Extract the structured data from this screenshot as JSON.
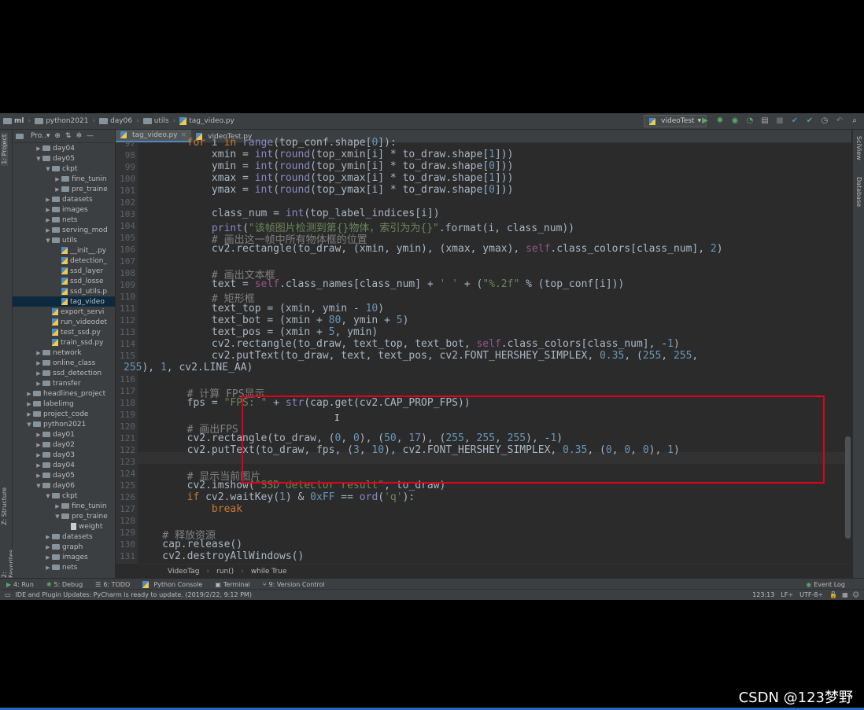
{
  "nav": {
    "crumbs": [
      "ml",
      "python2021",
      "day06",
      "utils",
      "tag_video.py"
    ],
    "run_config": "videoTest"
  },
  "left_stripe": {
    "project": "1: Project",
    "structure": "Z: Structure",
    "favorites": "2: Favorites"
  },
  "right_stripe": {
    "sciview": "SciView",
    "database": "Database"
  },
  "project": {
    "title": "Pro..▾",
    "tree": [
      {
        "label": "day04",
        "type": "folder",
        "arrow": "▶"
      },
      {
        "label": "day05",
        "type": "folder",
        "arrow": "▼"
      },
      {
        "label": "ckpt",
        "type": "folder",
        "arrow": "▼"
      },
      {
        "label": "fine_tunin",
        "type": "folder",
        "arrow": "▶"
      },
      {
        "label": "pre_traine",
        "type": "folder",
        "arrow": "▶"
      },
      {
        "label": "datasets",
        "type": "folder",
        "arrow": "▶"
      },
      {
        "label": "images",
        "type": "folder",
        "arrow": "▶"
      },
      {
        "label": "nets",
        "type": "folder",
        "arrow": "▶"
      },
      {
        "label": "serving_mod",
        "type": "folder",
        "arrow": "▶"
      },
      {
        "label": "utils",
        "type": "folder",
        "arrow": "▼"
      },
      {
        "label": "__init__.py",
        "type": "py",
        "arrow": ""
      },
      {
        "label": "detection_",
        "type": "py",
        "arrow": ""
      },
      {
        "label": "ssd_layer",
        "type": "py",
        "arrow": ""
      },
      {
        "label": "ssd_losse",
        "type": "py",
        "arrow": ""
      },
      {
        "label": "ssd_utils.p",
        "type": "py",
        "arrow": ""
      },
      {
        "label": "tag_video",
        "type": "py",
        "arrow": ""
      },
      {
        "label": "export_servi",
        "type": "py",
        "arrow": ""
      },
      {
        "label": "run_videodet",
        "type": "py",
        "arrow": ""
      },
      {
        "label": "test_ssd.py",
        "type": "py",
        "arrow": ""
      },
      {
        "label": "train_ssd.py",
        "type": "py",
        "arrow": ""
      },
      {
        "label": "network",
        "type": "folder",
        "arrow": "▶"
      },
      {
        "label": "online_class",
        "type": "folder",
        "arrow": "▶"
      },
      {
        "label": "ssd_detection",
        "type": "folder",
        "arrow": "▶"
      },
      {
        "label": "transfer",
        "type": "folder",
        "arrow": "▶"
      },
      {
        "label": "headlines_project",
        "type": "folder",
        "arrow": "▶"
      },
      {
        "label": "labelimg",
        "type": "folder",
        "arrow": "▶"
      },
      {
        "label": "project_code",
        "type": "folder",
        "arrow": "▶"
      },
      {
        "label": "python2021",
        "type": "folder",
        "arrow": "▼"
      },
      {
        "label": "day01",
        "type": "folder",
        "arrow": "▶"
      },
      {
        "label": "day02",
        "type": "folder",
        "arrow": "▶"
      },
      {
        "label": "day03",
        "type": "folder",
        "arrow": "▶"
      },
      {
        "label": "day04",
        "type": "folder",
        "arrow": "▶"
      },
      {
        "label": "day05",
        "type": "folder",
        "arrow": "▶"
      },
      {
        "label": "day06",
        "type": "folder",
        "arrow": "▼"
      },
      {
        "label": "ckpt",
        "type": "folder",
        "arrow": "▼"
      },
      {
        "label": "fine_tunin",
        "type": "folder",
        "arrow": "▶"
      },
      {
        "label": "pre_traine",
        "type": "folder",
        "arrow": "▼"
      },
      {
        "label": "weight",
        "type": "doc",
        "arrow": ""
      },
      {
        "label": "datasets",
        "type": "folder",
        "arrow": "▶"
      },
      {
        "label": "graph",
        "type": "folder",
        "arrow": "▶"
      },
      {
        "label": "images",
        "type": "folder",
        "arrow": "▶"
      },
      {
        "label": "nets",
        "type": "folder",
        "arrow": "▶"
      }
    ]
  },
  "tabs": [
    {
      "label": "tag_video.py",
      "active": true
    },
    {
      "label": "videoTest.py",
      "active": false
    }
  ],
  "editor": {
    "line_numbers": [
      "97",
      "98",
      "99",
      "100",
      "101",
      "102",
      "103",
      "104",
      "105",
      "106",
      "107",
      "108",
      "109",
      "110",
      "111",
      "112",
      "113",
      "114",
      "115",
      "",
      "116",
      "117",
      "118",
      "119",
      "120",
      "121",
      "122",
      "123",
      "124",
      "125",
      "126",
      "127",
      "128",
      "129",
      "130",
      "131"
    ],
    "breadcrumb": [
      "VideoTag",
      "run()",
      "while True"
    ]
  },
  "bottom_tools": [
    "4: Run",
    "5: Debug",
    "6: TODO",
    "Python Console",
    "Terminal",
    "9: Version Control",
    "Event Log"
  ],
  "status": {
    "message": "IDE and Plugin Updates: PyCharm is ready to update. (2019/2/22, 9:12 PM)",
    "position": "123:13",
    "line_sep": "LF÷",
    "encoding": "UTF-8÷"
  },
  "watermark": "CSDN @123梦野"
}
